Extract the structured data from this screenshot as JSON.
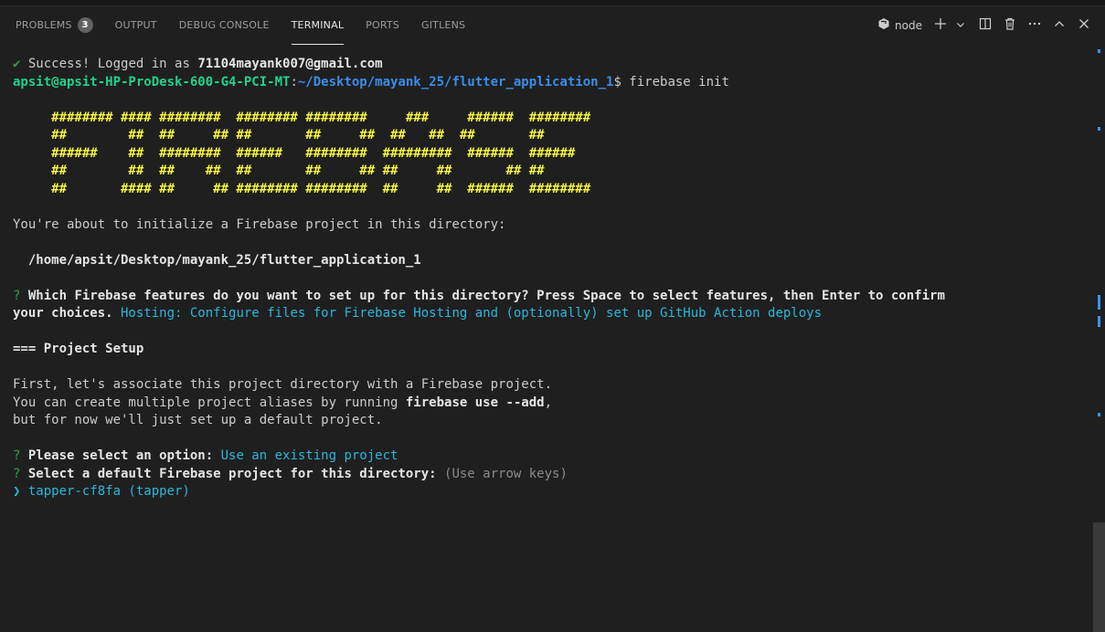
{
  "panel": {
    "tabs": [
      {
        "label": "PROBLEMS",
        "badge": "3"
      },
      {
        "label": "OUTPUT"
      },
      {
        "label": "DEBUG CONSOLE"
      },
      {
        "label": "TERMINAL"
      },
      {
        "label": "PORTS"
      },
      {
        "label": "GITLENS"
      }
    ],
    "active_tab": "TERMINAL",
    "terminal_name": "node",
    "toolbar_icons": [
      "node-icon",
      "add-terminal-icon",
      "chevron-down-icon",
      "split-terminal-icon",
      "trash-icon",
      "more-actions-icon",
      "maximize-panel-icon",
      "close-icon"
    ]
  },
  "terminal": {
    "login_check": "✔",
    "login_text": " Success! Logged in as ",
    "login_email": "71104mayank007@gmail.com",
    "prompt_user": "apsit@apsit-HP-ProDesk-600-G4-PCI-MT",
    "prompt_sep": ":",
    "prompt_path": "~/Desktop/mayank_25/flutter_application_1",
    "prompt_tail": "$ firebase init",
    "art": [
      "     ######## #### ########  ######## ########     ###     ######  ########",
      "     ##        ##  ##     ## ##       ##     ##  ##   ##  ##       ##",
      "     ######    ##  ########  ######   ########  #########  ######  ######",
      "     ##        ##  ##    ##  ##       ##     ## ##     ##       ## ##",
      "     ##       #### ##     ## ######## ########  ##     ##  ######  ########"
    ],
    "init_msg": "You're about to initialize a Firebase project in this directory:",
    "dir_path": "  /home/apsit/Desktop/mayank_25/flutter_application_1",
    "q1_mark": "?",
    "q1_text": " Which Firebase features do you want to set up for this directory? Press Space to select features, then Enter to confirm",
    "q1_text2": "your choices.",
    "q1_answer": " Hosting: Configure files for Firebase Hosting and (optionally) set up GitHub Action deploys",
    "section": "=== Project Setup",
    "para1": "First, let's associate this project directory with a Firebase project.",
    "para2_a": "You can create multiple project aliases by running ",
    "para2_b": "firebase use --add",
    "para2_c": ",",
    "para3": "but for now we'll just set up a default project.",
    "q2_mark": "?",
    "q2_text": " Please select an option:",
    "q2_answer": " Use an existing project",
    "q3_mark": "?",
    "q3_text": " Select a default Firebase project for this directory:",
    "q3_hint": " (Use arrow keys)",
    "choice": "❯ tapper-cf8fa (tapper)"
  },
  "colors": {
    "background": "#1f1f1f",
    "art": "#f5f543",
    "prompt_user": "#23d18b",
    "prompt_path": "#3b8eea",
    "cyan": "#29b8db"
  }
}
